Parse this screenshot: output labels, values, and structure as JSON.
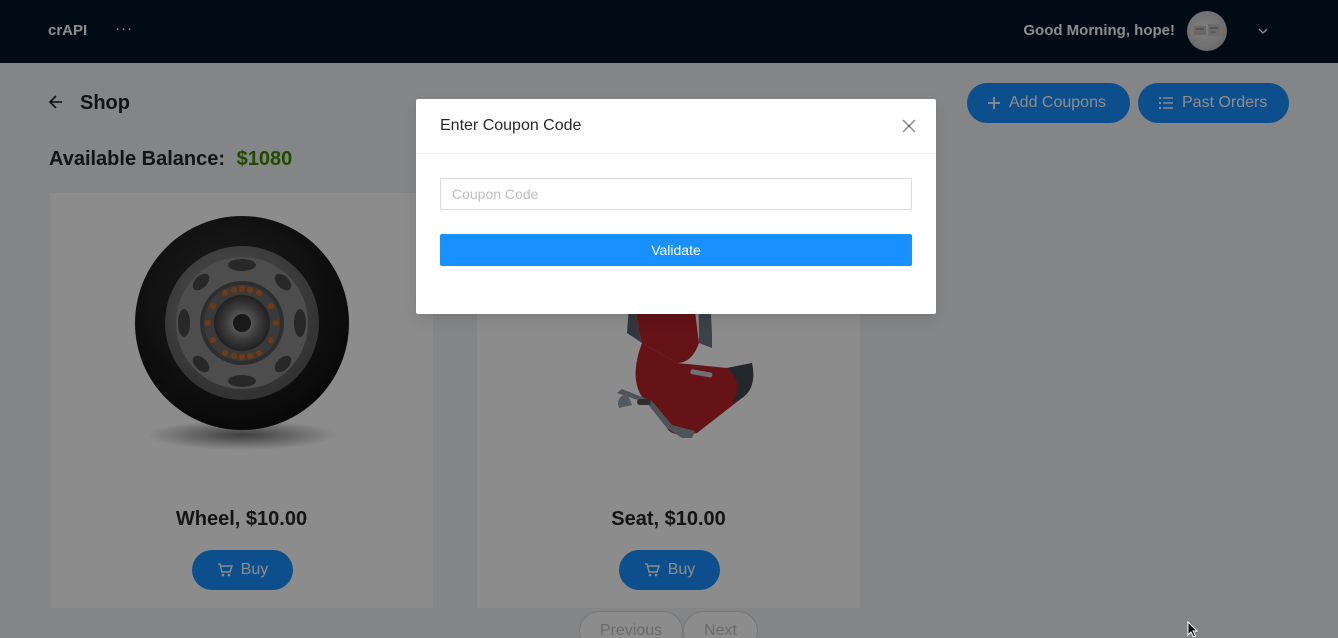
{
  "header": {
    "logo": "crAPI",
    "menu": "···",
    "greeting": "Good Morning, hope!"
  },
  "page": {
    "title": "Shop",
    "buttons": {
      "add_coupons": "Add Coupons",
      "past_orders": "Past Orders"
    },
    "balance": {
      "label": "Available Balance",
      "separator": ":",
      "amount": "$1080"
    },
    "products": [
      {
        "title": "Wheel, $10.00",
        "buy_label": "Buy",
        "image": "wheel"
      },
      {
        "title": "Seat, $10.00",
        "buy_label": "Buy",
        "image": "car-seat"
      }
    ],
    "pagination": {
      "previous": "Previous",
      "next": "Next"
    }
  },
  "modal": {
    "title": "Enter Coupon Code",
    "input_placeholder": "Coupon Code",
    "input_value": "",
    "validate_label": "Validate"
  },
  "colors": {
    "header_bg": "#001529",
    "primary": "#1890ff",
    "balance_green": "#3f8600"
  }
}
